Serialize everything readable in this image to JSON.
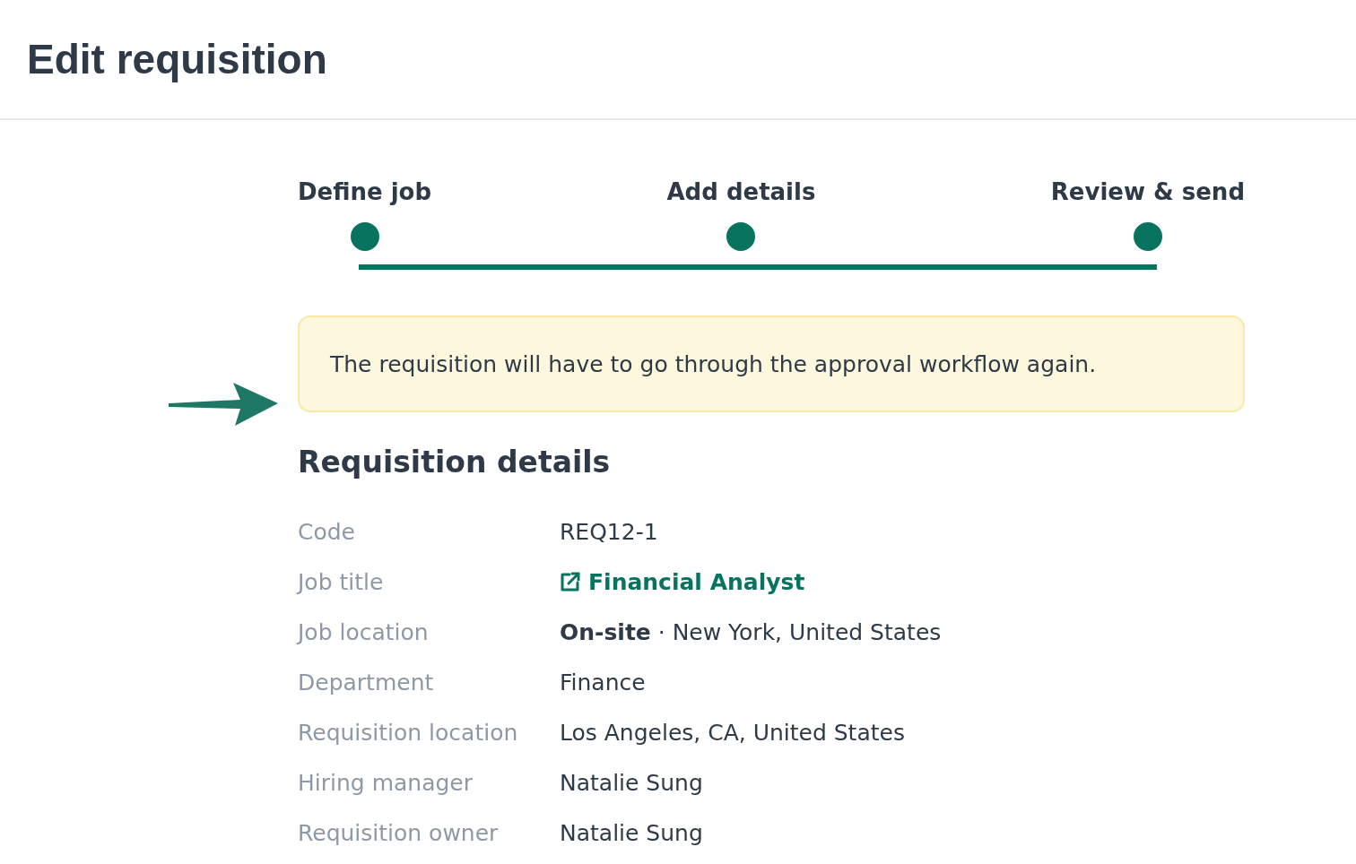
{
  "header": {
    "title": "Edit requisition"
  },
  "stepper": {
    "steps": [
      {
        "label": "Define job",
        "completed": true
      },
      {
        "label": "Add details",
        "completed": true
      },
      {
        "label": "Review & send",
        "completed": true
      }
    ]
  },
  "notice": {
    "text": "The requisition will have to go through the approval workflow again."
  },
  "details": {
    "title": "Requisition details",
    "rows": [
      {
        "label": "Code",
        "value": "REQ12-1",
        "kind": "text"
      },
      {
        "label": "Job title",
        "value": "Financial Analyst",
        "kind": "link"
      },
      {
        "label": "Job location",
        "value": "**On-site** · New York, United States",
        "kind": "text"
      },
      {
        "label": "Department",
        "value": "Finance",
        "kind": "text"
      },
      {
        "label": "Requisition location",
        "value": "Los Angeles, CA, United States",
        "kind": "text"
      },
      {
        "label": "Hiring manager",
        "value": "Natalie Sung",
        "kind": "text"
      },
      {
        "label": "Requisition owner",
        "value": "Natalie Sung",
        "kind": "text"
      }
    ]
  }
}
